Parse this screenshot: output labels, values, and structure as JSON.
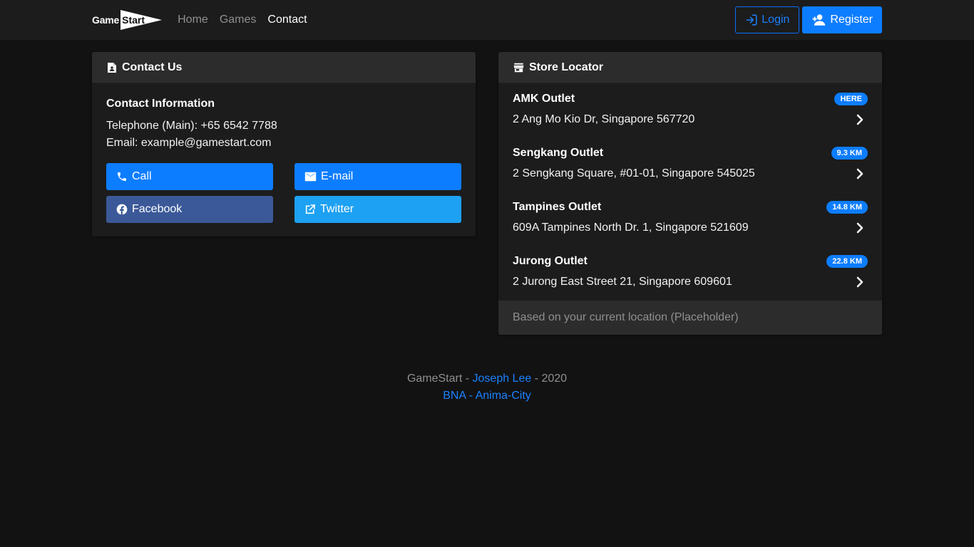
{
  "nav": {
    "brand_game": "Game",
    "brand_start": "Start",
    "links": [
      "Home",
      "Games",
      "Contact"
    ],
    "login": "Login",
    "register": "Register"
  },
  "contact": {
    "header": "Contact Us",
    "title": "Contact Information",
    "telephone": "Telephone (Main): +65 6542 7788",
    "email": "Email: example@gamestart.com",
    "buttons": {
      "call": "Call",
      "email": "E-mail",
      "facebook": "Facebook",
      "twitter": "Twitter"
    }
  },
  "stores": {
    "header": "Store Locator",
    "items": [
      {
        "name": "AMK Outlet",
        "address": "2 Ang Mo Kio Dr, Singapore 567720",
        "badge": "HERE"
      },
      {
        "name": "Sengkang Outlet",
        "address": "2 Sengkang Square, #01-01, Singapore 545025",
        "badge": "9.3 KM"
      },
      {
        "name": "Tampines Outlet",
        "address": "609A Tampines North Dr. 1, Singapore 521609",
        "badge": "14.8 KM"
      },
      {
        "name": "Jurong Outlet",
        "address": "2 Jurong East Street 21, Singapore 609601",
        "badge": "22.8 KM"
      }
    ],
    "footer": "Based on your current location (Placeholder)"
  },
  "footer": {
    "site": "GameStart",
    "sep1": " - ",
    "author": "Joseph Lee",
    "sep2": " - ",
    "year": "2020",
    "link1": "BNA",
    "sep3": " - ",
    "link2": "Anima-City"
  },
  "colors": {
    "accent": "#0d7dff",
    "facebook": "#3b5998",
    "twitter": "#1da1f2",
    "background": "#121212"
  }
}
